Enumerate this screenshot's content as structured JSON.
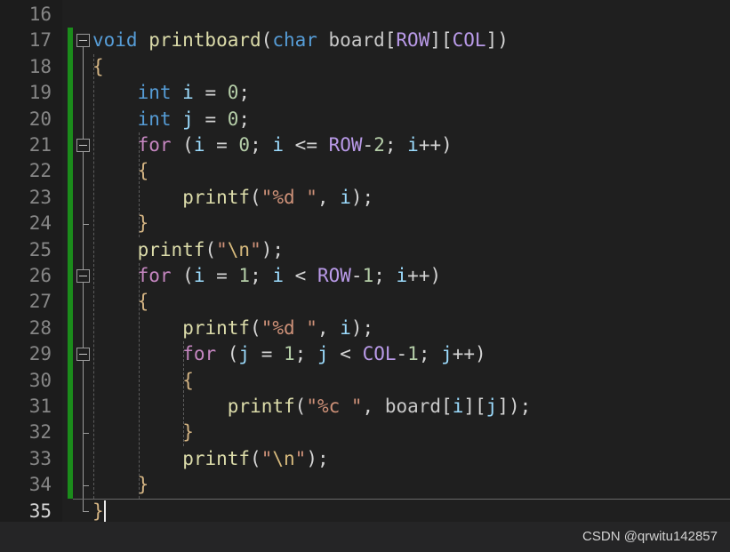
{
  "editor": {
    "theme": "dark-plus",
    "language": "c",
    "background": "#1f1f1f",
    "gutter_background": "#1c1c1c",
    "change_bar_color": "#1b8c1b",
    "current_line": 35,
    "first_visible_line": 16,
    "last_visible_line": 35
  },
  "watermark": {
    "text": "CSDN @qrwitu142857"
  },
  "lines": [
    {
      "number": "16",
      "indent": 0,
      "tokens": []
    },
    {
      "number": "17",
      "indent": 0,
      "tokens": [
        {
          "text": "void ",
          "cls": "t-kw"
        },
        {
          "text": "printboard",
          "cls": "t-fn"
        },
        {
          "text": "(",
          "cls": "t-paren"
        },
        {
          "text": "char ",
          "cls": "t-kw"
        },
        {
          "text": "board",
          "cls": "t-ident"
        },
        {
          "text": "[",
          "cls": "t-paren"
        },
        {
          "text": "ROW",
          "cls": "t-macro"
        },
        {
          "text": "][",
          "cls": "t-paren"
        },
        {
          "text": "COL",
          "cls": "t-macro"
        },
        {
          "text": "])",
          "cls": "t-paren"
        }
      ]
    },
    {
      "number": "18",
      "indent": 0,
      "tokens": [
        {
          "text": "{",
          "cls": "t-brace"
        }
      ]
    },
    {
      "number": "19",
      "indent": 1,
      "tokens": [
        {
          "text": "int ",
          "cls": "t-kw"
        },
        {
          "text": "i",
          "cls": "t-var"
        },
        {
          "text": " = ",
          "cls": "t-op"
        },
        {
          "text": "0",
          "cls": "t-num"
        },
        {
          "text": ";",
          "cls": "t-op"
        }
      ]
    },
    {
      "number": "20",
      "indent": 1,
      "tokens": [
        {
          "text": "int ",
          "cls": "t-kw"
        },
        {
          "text": "j",
          "cls": "t-var"
        },
        {
          "text": " = ",
          "cls": "t-op"
        },
        {
          "text": "0",
          "cls": "t-num"
        },
        {
          "text": ";",
          "cls": "t-op"
        }
      ]
    },
    {
      "number": "21",
      "indent": 1,
      "tokens": [
        {
          "text": "for ",
          "cls": "t-ctrl"
        },
        {
          "text": "(",
          "cls": "t-paren"
        },
        {
          "text": "i",
          "cls": "t-var"
        },
        {
          "text": " = ",
          "cls": "t-op"
        },
        {
          "text": "0",
          "cls": "t-num"
        },
        {
          "text": "; ",
          "cls": "t-op"
        },
        {
          "text": "i",
          "cls": "t-var"
        },
        {
          "text": " <= ",
          "cls": "t-op"
        },
        {
          "text": "ROW",
          "cls": "t-macro"
        },
        {
          "text": "-",
          "cls": "t-op"
        },
        {
          "text": "2",
          "cls": "t-num"
        },
        {
          "text": "; ",
          "cls": "t-op"
        },
        {
          "text": "i",
          "cls": "t-var"
        },
        {
          "text": "++)",
          "cls": "t-op"
        }
      ]
    },
    {
      "number": "22",
      "indent": 1,
      "tokens": [
        {
          "text": "{",
          "cls": "t-brace"
        }
      ]
    },
    {
      "number": "23",
      "indent": 2,
      "tokens": [
        {
          "text": "printf",
          "cls": "t-fn"
        },
        {
          "text": "(",
          "cls": "t-paren"
        },
        {
          "text": "\"%d \"",
          "cls": "t-str"
        },
        {
          "text": ", ",
          "cls": "t-op"
        },
        {
          "text": "i",
          "cls": "t-var"
        },
        {
          "text": ");",
          "cls": "t-op"
        }
      ]
    },
    {
      "number": "24",
      "indent": 1,
      "tokens": [
        {
          "text": "}",
          "cls": "t-brace"
        }
      ]
    },
    {
      "number": "25",
      "indent": 1,
      "tokens": [
        {
          "text": "printf",
          "cls": "t-fn"
        },
        {
          "text": "(",
          "cls": "t-paren"
        },
        {
          "text": "\"",
          "cls": "t-str"
        },
        {
          "text": "\\n",
          "cls": "t-esc"
        },
        {
          "text": "\"",
          "cls": "t-str"
        },
        {
          "text": ");",
          "cls": "t-op"
        }
      ]
    },
    {
      "number": "26",
      "indent": 1,
      "tokens": [
        {
          "text": "for ",
          "cls": "t-ctrl"
        },
        {
          "text": "(",
          "cls": "t-paren"
        },
        {
          "text": "i",
          "cls": "t-var"
        },
        {
          "text": " = ",
          "cls": "t-op"
        },
        {
          "text": "1",
          "cls": "t-num"
        },
        {
          "text": "; ",
          "cls": "t-op"
        },
        {
          "text": "i",
          "cls": "t-var"
        },
        {
          "text": " < ",
          "cls": "t-op"
        },
        {
          "text": "ROW",
          "cls": "t-macro"
        },
        {
          "text": "-",
          "cls": "t-op"
        },
        {
          "text": "1",
          "cls": "t-num"
        },
        {
          "text": "; ",
          "cls": "t-op"
        },
        {
          "text": "i",
          "cls": "t-var"
        },
        {
          "text": "++)",
          "cls": "t-op"
        }
      ]
    },
    {
      "number": "27",
      "indent": 1,
      "tokens": [
        {
          "text": "{",
          "cls": "t-brace"
        }
      ]
    },
    {
      "number": "28",
      "indent": 2,
      "tokens": [
        {
          "text": "printf",
          "cls": "t-fn"
        },
        {
          "text": "(",
          "cls": "t-paren"
        },
        {
          "text": "\"%d \"",
          "cls": "t-str"
        },
        {
          "text": ", ",
          "cls": "t-op"
        },
        {
          "text": "i",
          "cls": "t-var"
        },
        {
          "text": ");",
          "cls": "t-op"
        }
      ]
    },
    {
      "number": "29",
      "indent": 2,
      "tokens": [
        {
          "text": "for ",
          "cls": "t-ctrl"
        },
        {
          "text": "(",
          "cls": "t-paren"
        },
        {
          "text": "j",
          "cls": "t-var"
        },
        {
          "text": " = ",
          "cls": "t-op"
        },
        {
          "text": "1",
          "cls": "t-num"
        },
        {
          "text": "; ",
          "cls": "t-op"
        },
        {
          "text": "j",
          "cls": "t-var"
        },
        {
          "text": " < ",
          "cls": "t-op"
        },
        {
          "text": "COL",
          "cls": "t-macro"
        },
        {
          "text": "-",
          "cls": "t-op"
        },
        {
          "text": "1",
          "cls": "t-num"
        },
        {
          "text": "; ",
          "cls": "t-op"
        },
        {
          "text": "j",
          "cls": "t-var"
        },
        {
          "text": "++)",
          "cls": "t-op"
        }
      ]
    },
    {
      "number": "30",
      "indent": 2,
      "tokens": [
        {
          "text": "{",
          "cls": "t-brace"
        }
      ]
    },
    {
      "number": "31",
      "indent": 3,
      "tokens": [
        {
          "text": "printf",
          "cls": "t-fn"
        },
        {
          "text": "(",
          "cls": "t-paren"
        },
        {
          "text": "\"%c \"",
          "cls": "t-str"
        },
        {
          "text": ", ",
          "cls": "t-op"
        },
        {
          "text": "board",
          "cls": "t-ident"
        },
        {
          "text": "[",
          "cls": "t-paren"
        },
        {
          "text": "i",
          "cls": "t-var"
        },
        {
          "text": "][",
          "cls": "t-paren"
        },
        {
          "text": "j",
          "cls": "t-var"
        },
        {
          "text": "]);",
          "cls": "t-op"
        }
      ]
    },
    {
      "number": "32",
      "indent": 2,
      "tokens": [
        {
          "text": "}",
          "cls": "t-brace"
        }
      ]
    },
    {
      "number": "33",
      "indent": 2,
      "tokens": [
        {
          "text": "printf",
          "cls": "t-fn"
        },
        {
          "text": "(",
          "cls": "t-paren"
        },
        {
          "text": "\"",
          "cls": "t-str"
        },
        {
          "text": "\\n",
          "cls": "t-esc"
        },
        {
          "text": "\"",
          "cls": "t-str"
        },
        {
          "text": ");",
          "cls": "t-op"
        }
      ]
    },
    {
      "number": "34",
      "indent": 1,
      "tokens": [
        {
          "text": "}",
          "cls": "t-brace"
        }
      ]
    },
    {
      "number": "35",
      "indent": 0,
      "tokens": [
        {
          "text": "}",
          "cls": "t-brace"
        }
      ]
    }
  ],
  "fold_markers": [
    {
      "line": 17,
      "state": "expanded"
    },
    {
      "line": 21,
      "state": "expanded"
    },
    {
      "line": 26,
      "state": "expanded"
    },
    {
      "line": 29,
      "state": "expanded"
    }
  ]
}
